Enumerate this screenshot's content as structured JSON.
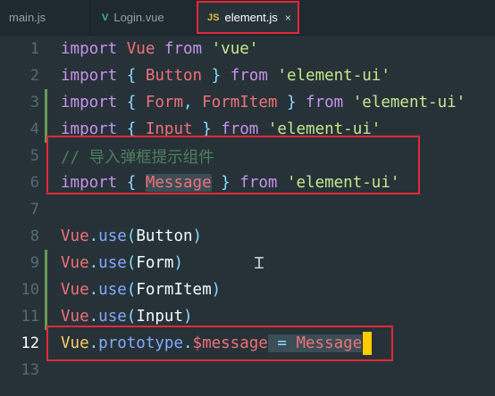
{
  "tabs": [
    {
      "label": "main.js",
      "icon": "js-icon",
      "icon_text": "JS",
      "active": false
    },
    {
      "label": "Login.vue",
      "icon": "vue-icon",
      "icon_text": "V",
      "active": false
    },
    {
      "label": "element.js",
      "icon": "js-icon",
      "icon_text": "JS",
      "active": true,
      "close_glyph": "×"
    }
  ],
  "lines": [
    {
      "number": "1",
      "tokens": [
        "import",
        " ",
        "Vue",
        " ",
        "from",
        " ",
        "'vue'"
      ]
    },
    {
      "number": "2",
      "tokens": [
        "import",
        " ",
        "{",
        " ",
        "Button",
        " ",
        "}",
        " ",
        "from",
        " ",
        "'element-ui'"
      ]
    },
    {
      "number": "3",
      "tokens": [
        "import",
        " ",
        "{",
        " ",
        "Form",
        ",",
        " ",
        "FormItem",
        " ",
        "}",
        " ",
        "from",
        " ",
        "'element-ui'"
      ]
    },
    {
      "number": "4",
      "tokens": [
        "import",
        " ",
        "{",
        " ",
        "Input",
        " ",
        "}",
        " ",
        "from",
        " ",
        "'element-ui'"
      ]
    },
    {
      "number": "5",
      "tokens": [
        "// 导入弹框提示组件"
      ]
    },
    {
      "number": "6",
      "tokens": [
        "import",
        " ",
        "{",
        " ",
        "Message",
        " ",
        "}",
        " ",
        "from",
        " ",
        "'element-ui'"
      ]
    },
    {
      "number": "7",
      "tokens": []
    },
    {
      "number": "8",
      "tokens": [
        "Vue",
        ".",
        "use",
        "(",
        "Button",
        ")"
      ]
    },
    {
      "number": "9",
      "tokens": [
        "Vue",
        ".",
        "use",
        "(",
        "Form",
        ")"
      ]
    },
    {
      "number": "10",
      "tokens": [
        "Vue",
        ".",
        "use",
        "(",
        "FormItem",
        ")"
      ]
    },
    {
      "number": "11",
      "tokens": [
        "Vue",
        ".",
        "use",
        "(",
        "Input",
        ")"
      ]
    },
    {
      "number": "12",
      "tokens": [
        "Vue",
        ".",
        "prototype",
        ".",
        "$message",
        " ",
        "=",
        " ",
        "Message"
      ]
    },
    {
      "number": "13",
      "tokens": []
    }
  ],
  "active_line": "12",
  "colors": {
    "background": "#263238",
    "keyword": "#c792ea",
    "identifier": "#f07178",
    "string": "#c3e88d",
    "comment": "#4f7f5e",
    "property": "#82aaff",
    "highlight_box": "#e5283a",
    "cursor": "#ffcc00"
  }
}
